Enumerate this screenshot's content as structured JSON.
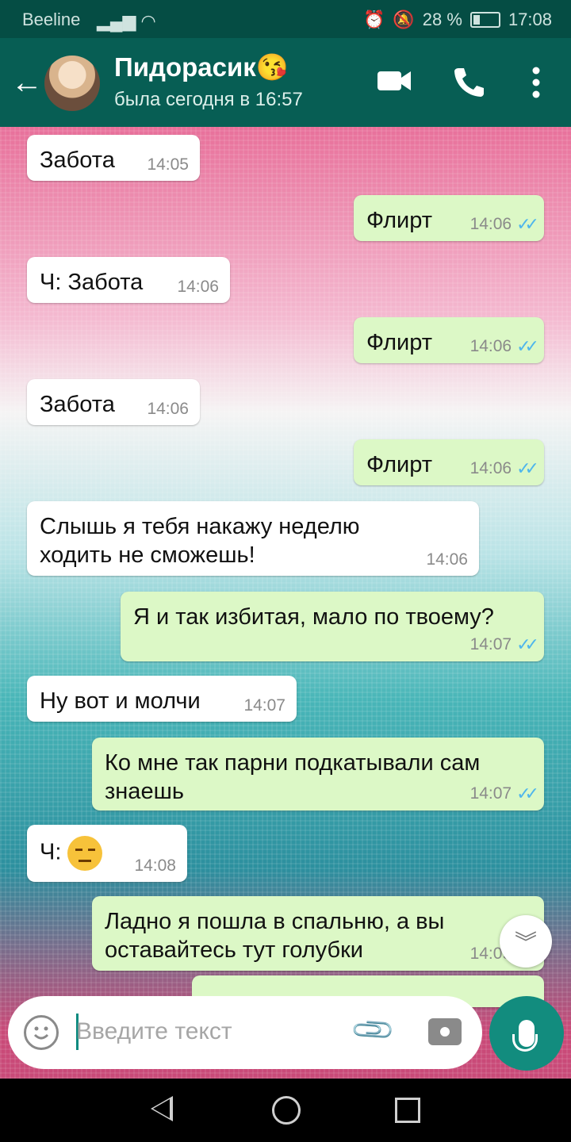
{
  "status_bar": {
    "carrier": "Beeline",
    "battery": "28 %",
    "time": "17:08"
  },
  "header": {
    "contact_name": "Пидорасик😘",
    "last_seen": "была сегодня в 16:57"
  },
  "messages": [
    {
      "dir": "in",
      "text": "Забота",
      "time": "14:05"
    },
    {
      "dir": "out",
      "text": "Флирт",
      "time": "14:06"
    },
    {
      "dir": "in",
      "text": "Ч: Забота",
      "time": "14:06"
    },
    {
      "dir": "out",
      "text": "Флирт",
      "time": "14:06"
    },
    {
      "dir": "in",
      "text": "Забота",
      "time": "14:06"
    },
    {
      "dir": "out",
      "text": "Флирт",
      "time": "14:06"
    },
    {
      "dir": "in",
      "text": "Слышь я тебя накажу неделю ходить не сможешь!",
      "time": "14:06"
    },
    {
      "dir": "out",
      "text": "Я и так избитая, мало по твоему?",
      "time": "14:07"
    },
    {
      "dir": "in",
      "text": "Ну вот и молчи",
      "time": "14:07"
    },
    {
      "dir": "out",
      "text": "Ко мне так парни подкатывали сам знаешь",
      "time": "14:07"
    },
    {
      "dir": "in",
      "text": "Ч:",
      "time": "14:08",
      "emoji": "unamused-face"
    },
    {
      "dir": "out",
      "text": "Ладно я пошла в спальню, а вы оставайтесь тут голубки",
      "time": "14:09"
    }
  ],
  "input": {
    "placeholder": "Введите текст"
  },
  "icons": {
    "tick_color": "#4fb6ec",
    "header_color": "#075e54",
    "accent": "#128c7e"
  }
}
